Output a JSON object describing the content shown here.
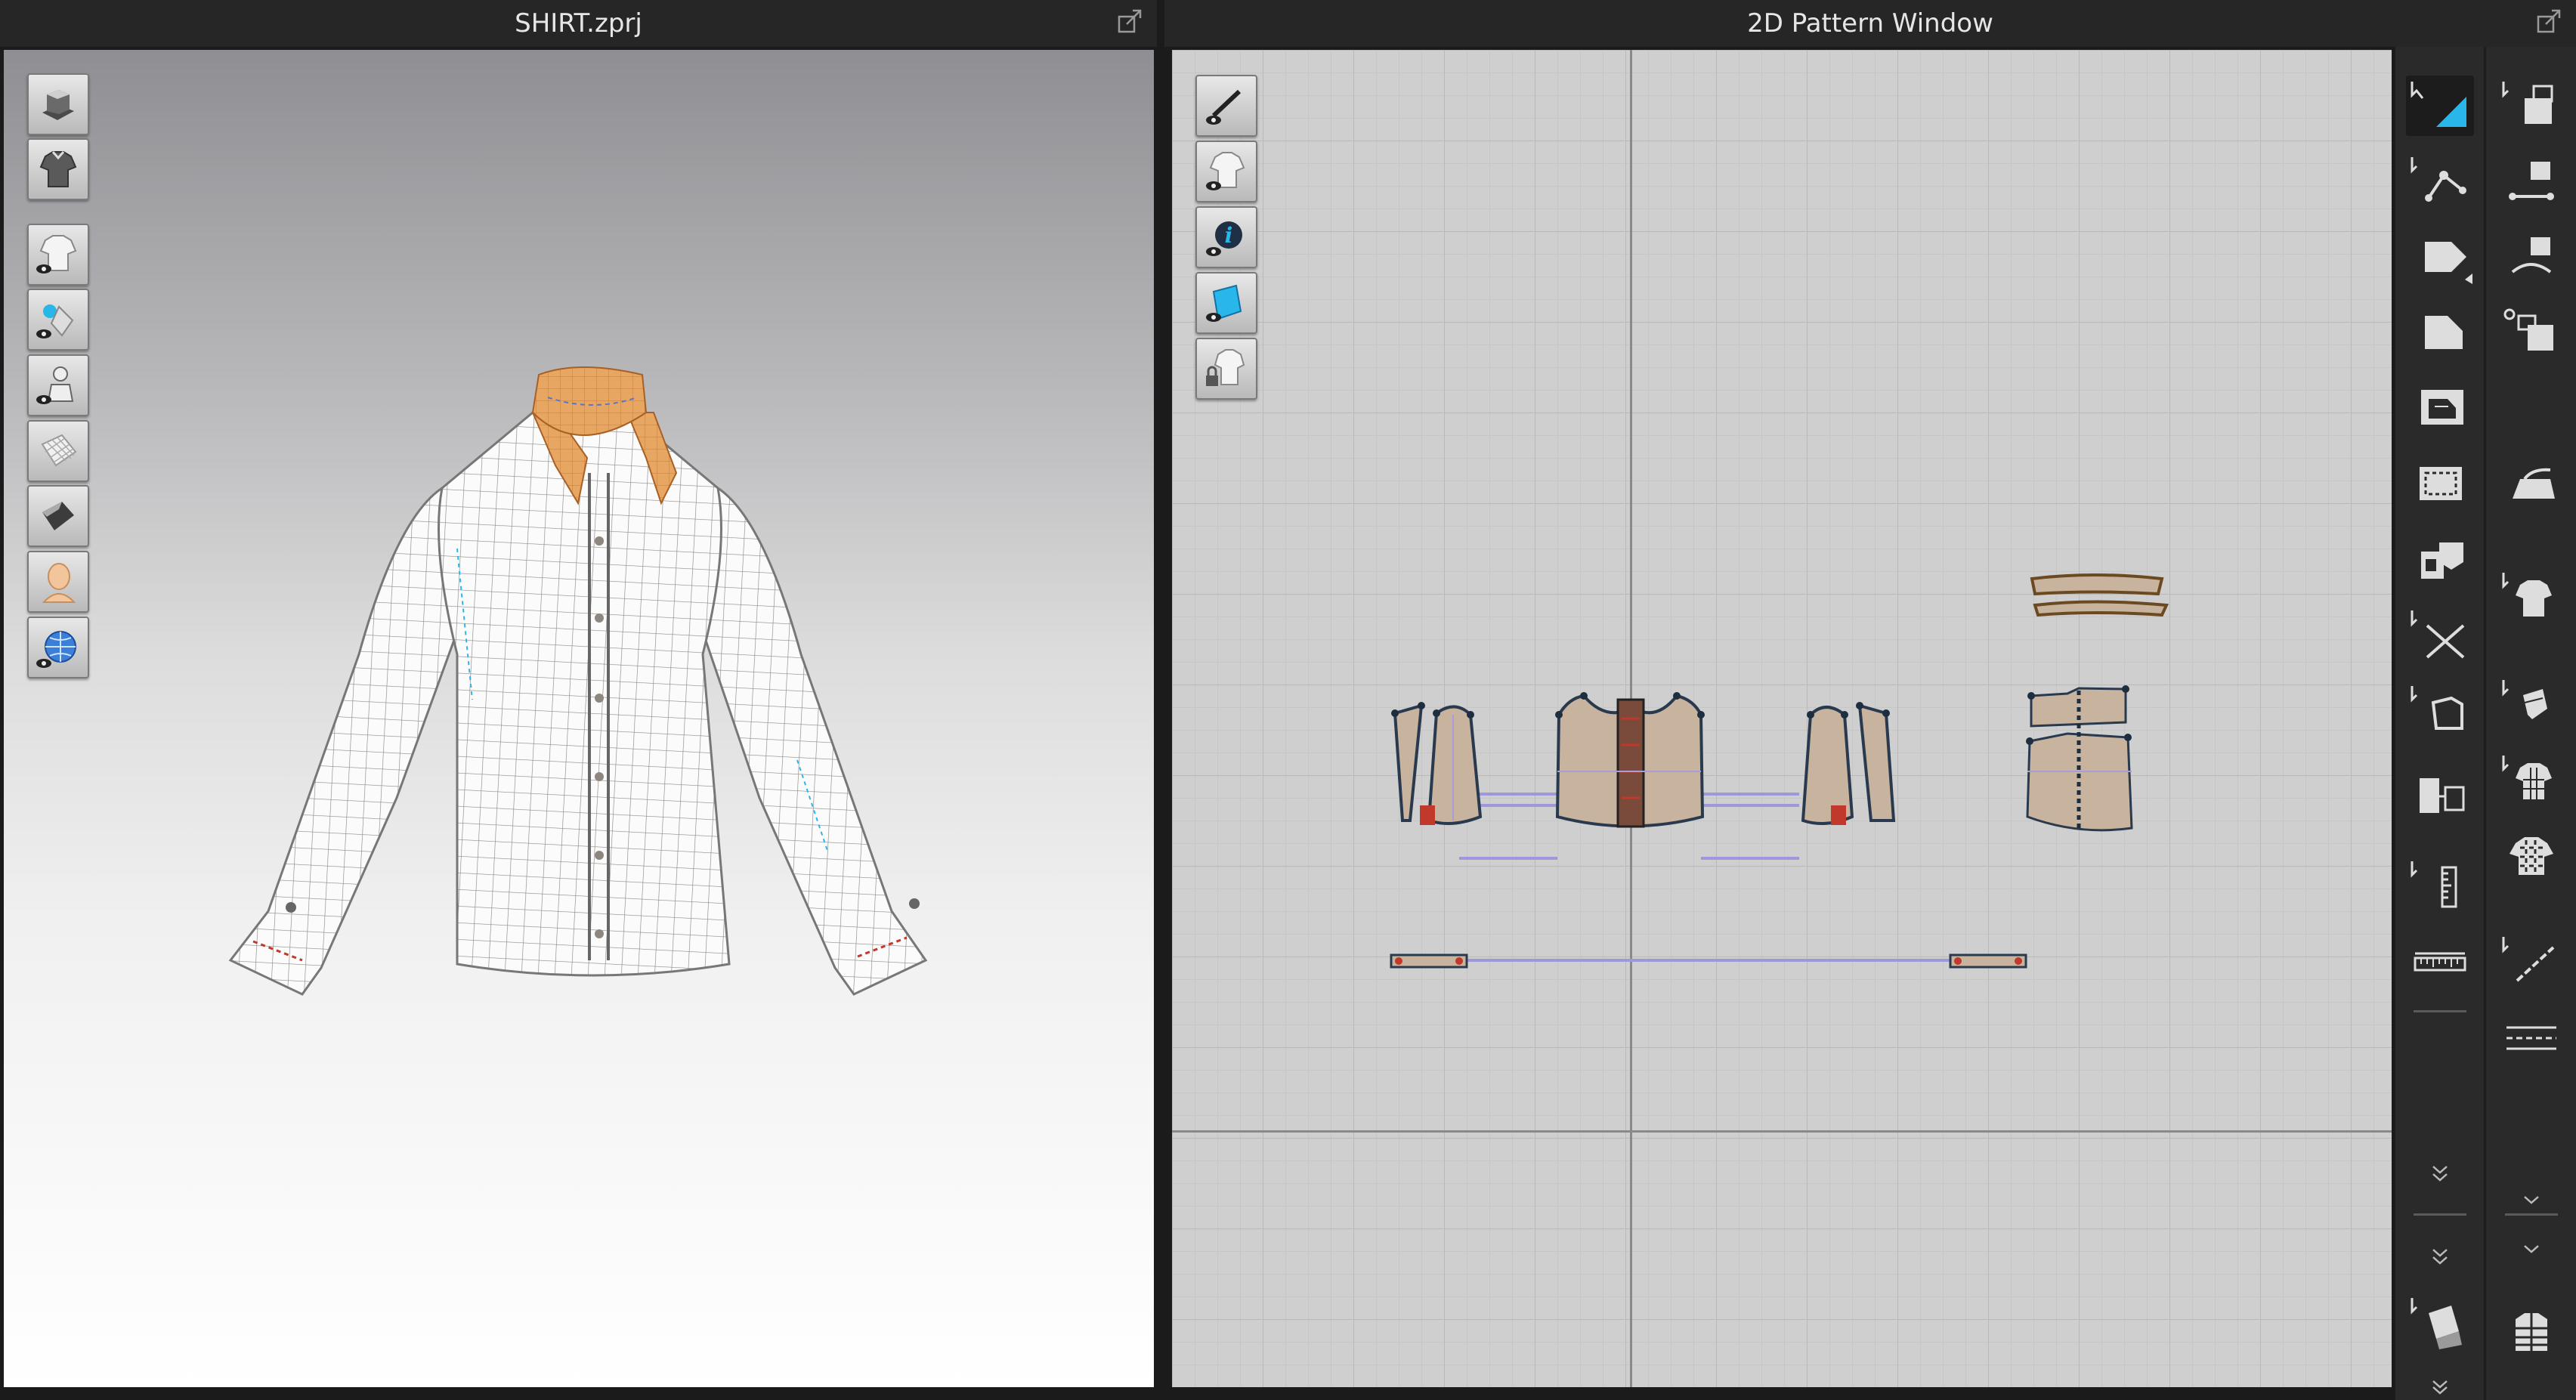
{
  "left_panel": {
    "title": "SHIRT.zprj",
    "popout_icon": "popout-icon",
    "view_tools": [
      "avatar-display-icon",
      "garment-display-icon",
      "show-garment-icon",
      "show-pins-arrangement-icon",
      "show-avatar-icon",
      "texture-mesh-icon",
      "shaded-surface-icon",
      "avatar-skin-icon",
      "environment-globe-icon"
    ]
  },
  "right_panel": {
    "title": "2D Pattern Window",
    "popout_icon": "popout-icon",
    "view_tools": [
      "show-2d-pattern-line-icon",
      "show-2d-garment-icon",
      "pattern-info-icon",
      "fabric-texture-icon",
      "lock-garment-icon"
    ],
    "tools_col1": [
      "transform-pattern-icon",
      "edit-point-line-icon",
      "polygon-pattern-icon",
      "rectangle-pattern-icon",
      "internal-rectangle-icon",
      "trace-pattern-icon",
      "fold-pattern-icon",
      "cut-line-icon",
      "offset-pattern-icon",
      "sync-pattern-icon",
      "tape-measure-icon",
      "ruler-icon",
      "expand-more-icon",
      "expand-more-icon",
      "fold-arrangement-icon",
      "expand-more-icon"
    ],
    "tools_col2": [
      "segment-sewing-icon",
      "free-sewing-icon",
      "multi-sewing-icon",
      "check-sewing-icon",
      "iron-icon",
      "shirt-fit-icon",
      "tack-icon",
      "shirt-grid-icon",
      "shirt-pattern-icon",
      "line-tool-icon",
      "topstitch-icon",
      "expand-more-icon",
      "expand-more-icon",
      "layers-garment-icon"
    ]
  },
  "colors": {
    "collar": "#e8a663",
    "pattern_fill": "#c8b49e",
    "pattern_outline": "#2a3a4e",
    "sewing_line": "#9d98dc",
    "active_tool_accent": "#29b6e8",
    "seam_red": "#c0392b"
  }
}
